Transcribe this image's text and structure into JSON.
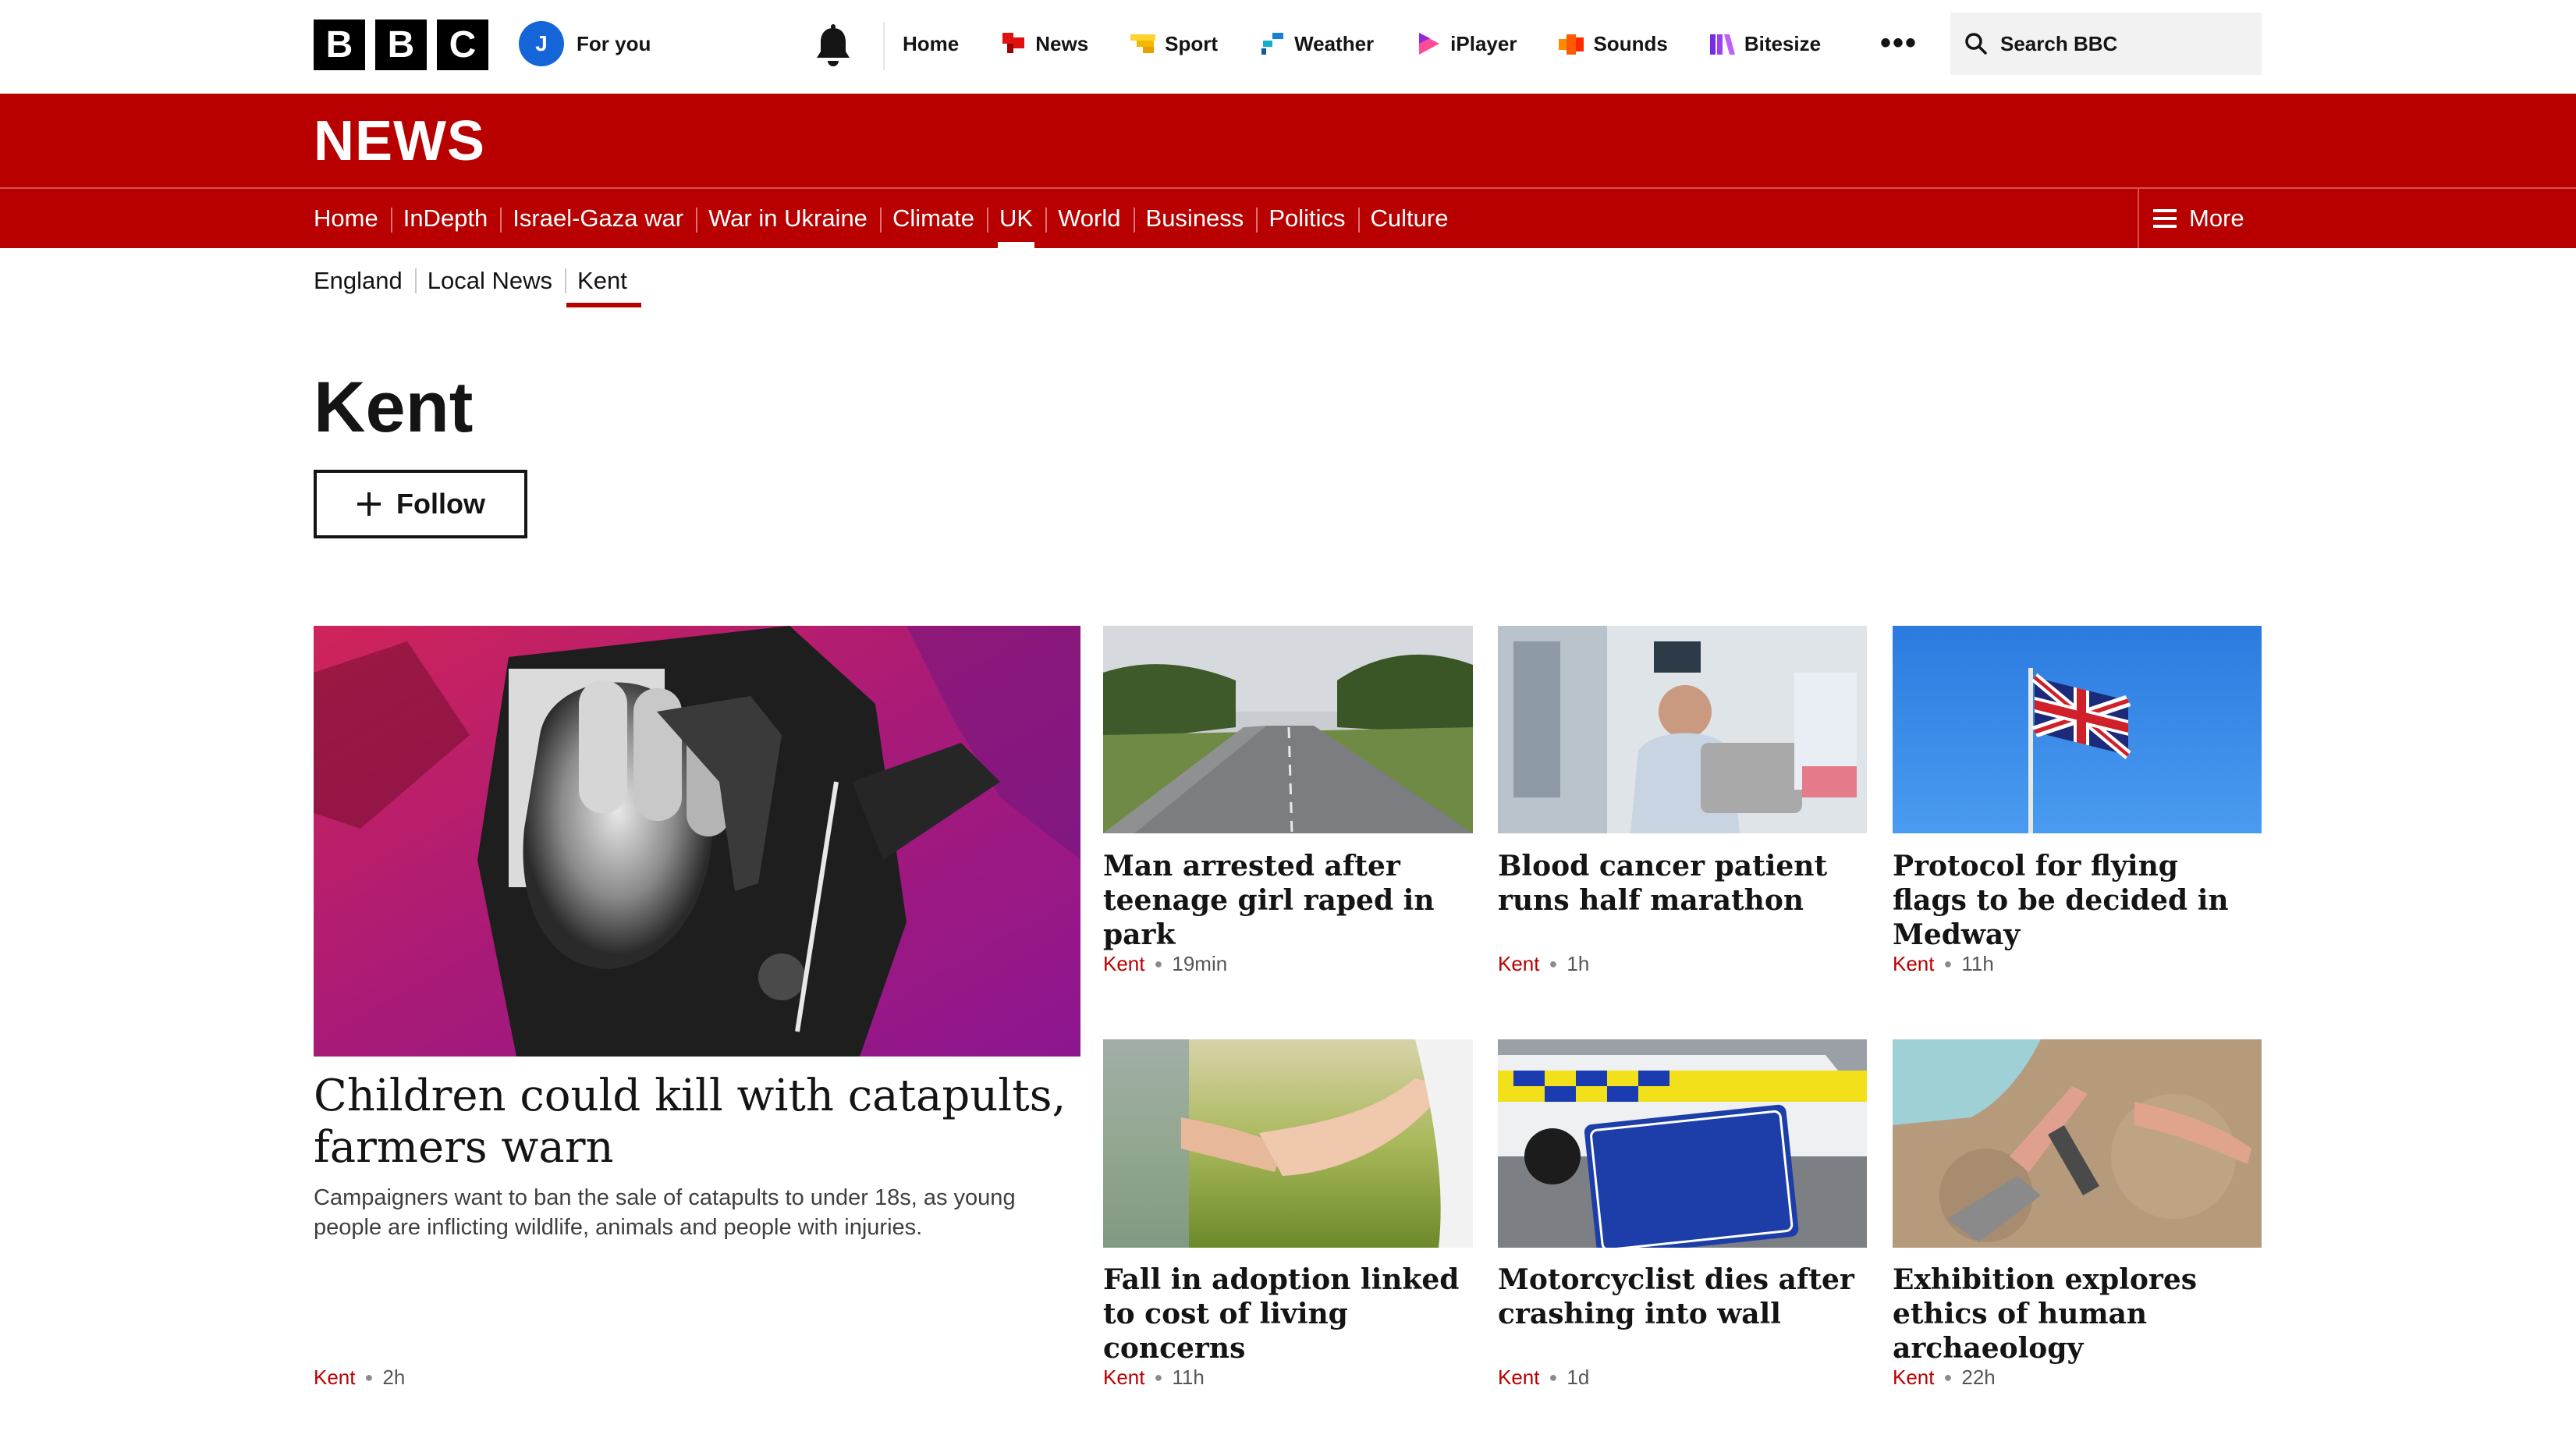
{
  "top": {
    "logo_letters": [
      "B",
      "B",
      "C"
    ],
    "avatar_initial": "J",
    "for_you": "For you",
    "nav": [
      {
        "label": "Home",
        "icon": "home-icon"
      },
      {
        "label": "News",
        "icon": "news-icon"
      },
      {
        "label": "Sport",
        "icon": "sport-icon"
      },
      {
        "label": "Weather",
        "icon": "weather-icon"
      },
      {
        "label": "iPlayer",
        "icon": "iplayer-icon"
      },
      {
        "label": "Sounds",
        "icon": "sounds-icon"
      },
      {
        "label": "Bitesize",
        "icon": "bitesize-icon"
      }
    ],
    "more_dots": "•••",
    "search_label": "Search BBC"
  },
  "news": {
    "brand": "NEWS",
    "nav": [
      "Home",
      "InDepth",
      "Israel-Gaza war",
      "War in Ukraine",
      "Climate",
      "UK",
      "World",
      "Business",
      "Politics",
      "Culture"
    ],
    "active_nav": "UK",
    "more_label": "More"
  },
  "subnav": {
    "items": [
      "England",
      "Local News",
      "Kent"
    ],
    "active": "Kent"
  },
  "page": {
    "title": "Kent",
    "follow_label": "Follow"
  },
  "lead_story": {
    "headline": "Children could kill with catapults, farmers warn",
    "summary": "Campaigners want to ban the sale of catapults to under 18s, as young people are inflicting wildlife, animals and people with injuries.",
    "location": "Kent",
    "time": "2h"
  },
  "stories": [
    {
      "headline": "Man arrested after teenage girl raped in park",
      "location": "Kent",
      "time": "19min"
    },
    {
      "headline": "Blood cancer patient runs half marathon",
      "location": "Kent",
      "time": "1h"
    },
    {
      "headline": "Protocol for flying flags to be decided in Medway",
      "location": "Kent",
      "time": "11h"
    },
    {
      "headline": "Fall in adoption linked to cost of living concerns",
      "location": "Kent",
      "time": "11h"
    },
    {
      "headline": "Motorcyclist dies after crashing into wall",
      "location": "Kent",
      "time": "1d"
    },
    {
      "headline": "Exhibition explores ethics of human archaeology",
      "location": "Kent",
      "time": "22h"
    }
  ],
  "colors": {
    "brand_red": "#b80000",
    "avatar_blue": "#1565d8",
    "text": "#141414"
  }
}
